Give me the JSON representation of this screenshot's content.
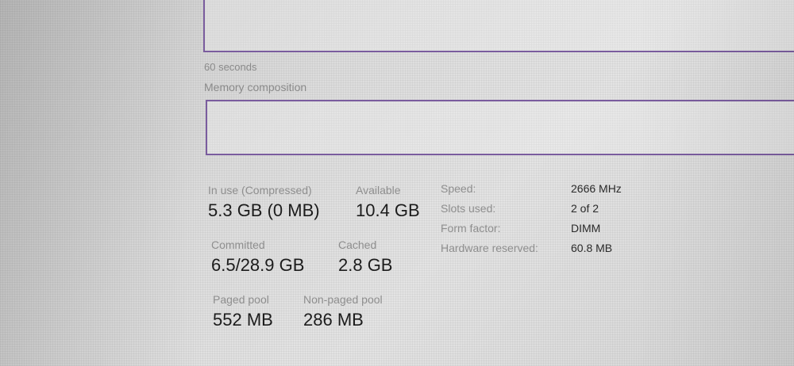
{
  "graph": {
    "time_label": "60 seconds"
  },
  "composition": {
    "label": "Memory composition"
  },
  "stats": {
    "in_use": {
      "label": "In use (Compressed)",
      "value": "5.3 GB (0 MB)"
    },
    "available": {
      "label": "Available",
      "value": "10.4 GB"
    },
    "committed": {
      "label": "Committed",
      "value": "6.5/28.9 GB"
    },
    "cached": {
      "label": "Cached",
      "value": "2.8 GB"
    },
    "paged_pool": {
      "label": "Paged pool",
      "value": "552 MB"
    },
    "non_paged_pool": {
      "label": "Non-paged pool",
      "value": "286 MB"
    }
  },
  "properties": [
    {
      "label": "Speed:",
      "value": "2666 MHz"
    },
    {
      "label": "Slots used:",
      "value": "2 of 2"
    },
    {
      "label": "Form factor:",
      "value": "DIMM"
    },
    {
      "label": "Hardware reserved:",
      "value": "60.8 MB"
    }
  ],
  "colors": {
    "graph_border": "#7a5c9e",
    "label_gray": "#8e8e8e",
    "value_dark": "#1c1c1c"
  }
}
